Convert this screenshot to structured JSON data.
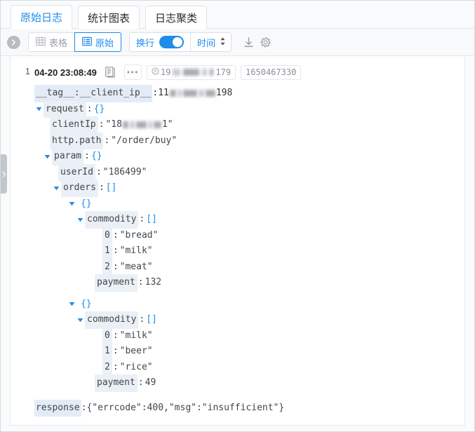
{
  "tabs": [
    {
      "label": "原始日志",
      "active": true,
      "name": "tab-raw-logs"
    },
    {
      "label": "统计图表",
      "active": false,
      "name": "tab-statistics-chart"
    },
    {
      "label": "日志聚类",
      "active": false,
      "name": "tab-log-clustering"
    }
  ],
  "toolbar": {
    "collapse_icon": "chevron-right-icon",
    "view_table_label": "表格",
    "view_table_icon": "table-grid-icon",
    "view_raw_label": "原始",
    "view_raw_icon": "list-lines-icon",
    "wrap_label": "换行",
    "wrap_enabled": true,
    "time_label": "时间",
    "time_sort_icon": "sort-updown-icon",
    "download_icon": "download-icon",
    "settings_icon": "gear-icon"
  },
  "log_entry": {
    "line_number": "1",
    "timestamp": "04-20 23:08:49",
    "copy_icon": "copy-document-icon",
    "more_icon": "ellipsis-icon",
    "source_chip_prefix": "19",
    "source_chip_suffix": "179",
    "source_chip_icon": "ip-circle-icon",
    "time_chip": "1650467330",
    "tag_key": "__tag__:__client_ip__",
    "tag_value_prefix": ":11",
    "tag_value_suffix": "198"
  },
  "tree": {
    "request_key": "request",
    "request_value": "{}",
    "clientIp_key": "clientIp",
    "clientIp_prefix": "\"18",
    "clientIp_suffix": "1\"",
    "httppath_key": "http.path",
    "httppath_value": "\"/order/buy\"",
    "param_key": "param",
    "param_value": "{}",
    "userId_key": "userId",
    "userId_value": "\"186499\"",
    "orders_key": "orders",
    "orders_value": "[]",
    "obj_brace": "{}",
    "commodity_key": "commodity",
    "commodity_value": "[]",
    "order1": {
      "idx0": "0",
      "val0": "\"bread\"",
      "idx1": "1",
      "val1": "\"milk\"",
      "idx2": "2",
      "val2": "\"meat\"",
      "payment_key": "payment",
      "payment_value": "132"
    },
    "order2": {
      "idx0": "0",
      "val0": "\"milk\"",
      "idx1": "1",
      "val1": "\"beer\"",
      "idx2": "2",
      "val2": "\"rice\"",
      "payment_key": "payment",
      "payment_value": "49"
    },
    "response_key": "response",
    "response_value": ":{\"errcode\":400,\"msg\":\"insufficient\"}"
  },
  "colors": {
    "accent": "#1f8ceb",
    "key_bg": "#eaf0f6",
    "border": "#dfe3e8",
    "panel_bg": "#ffffff",
    "app_bg": "#fafbfc"
  }
}
